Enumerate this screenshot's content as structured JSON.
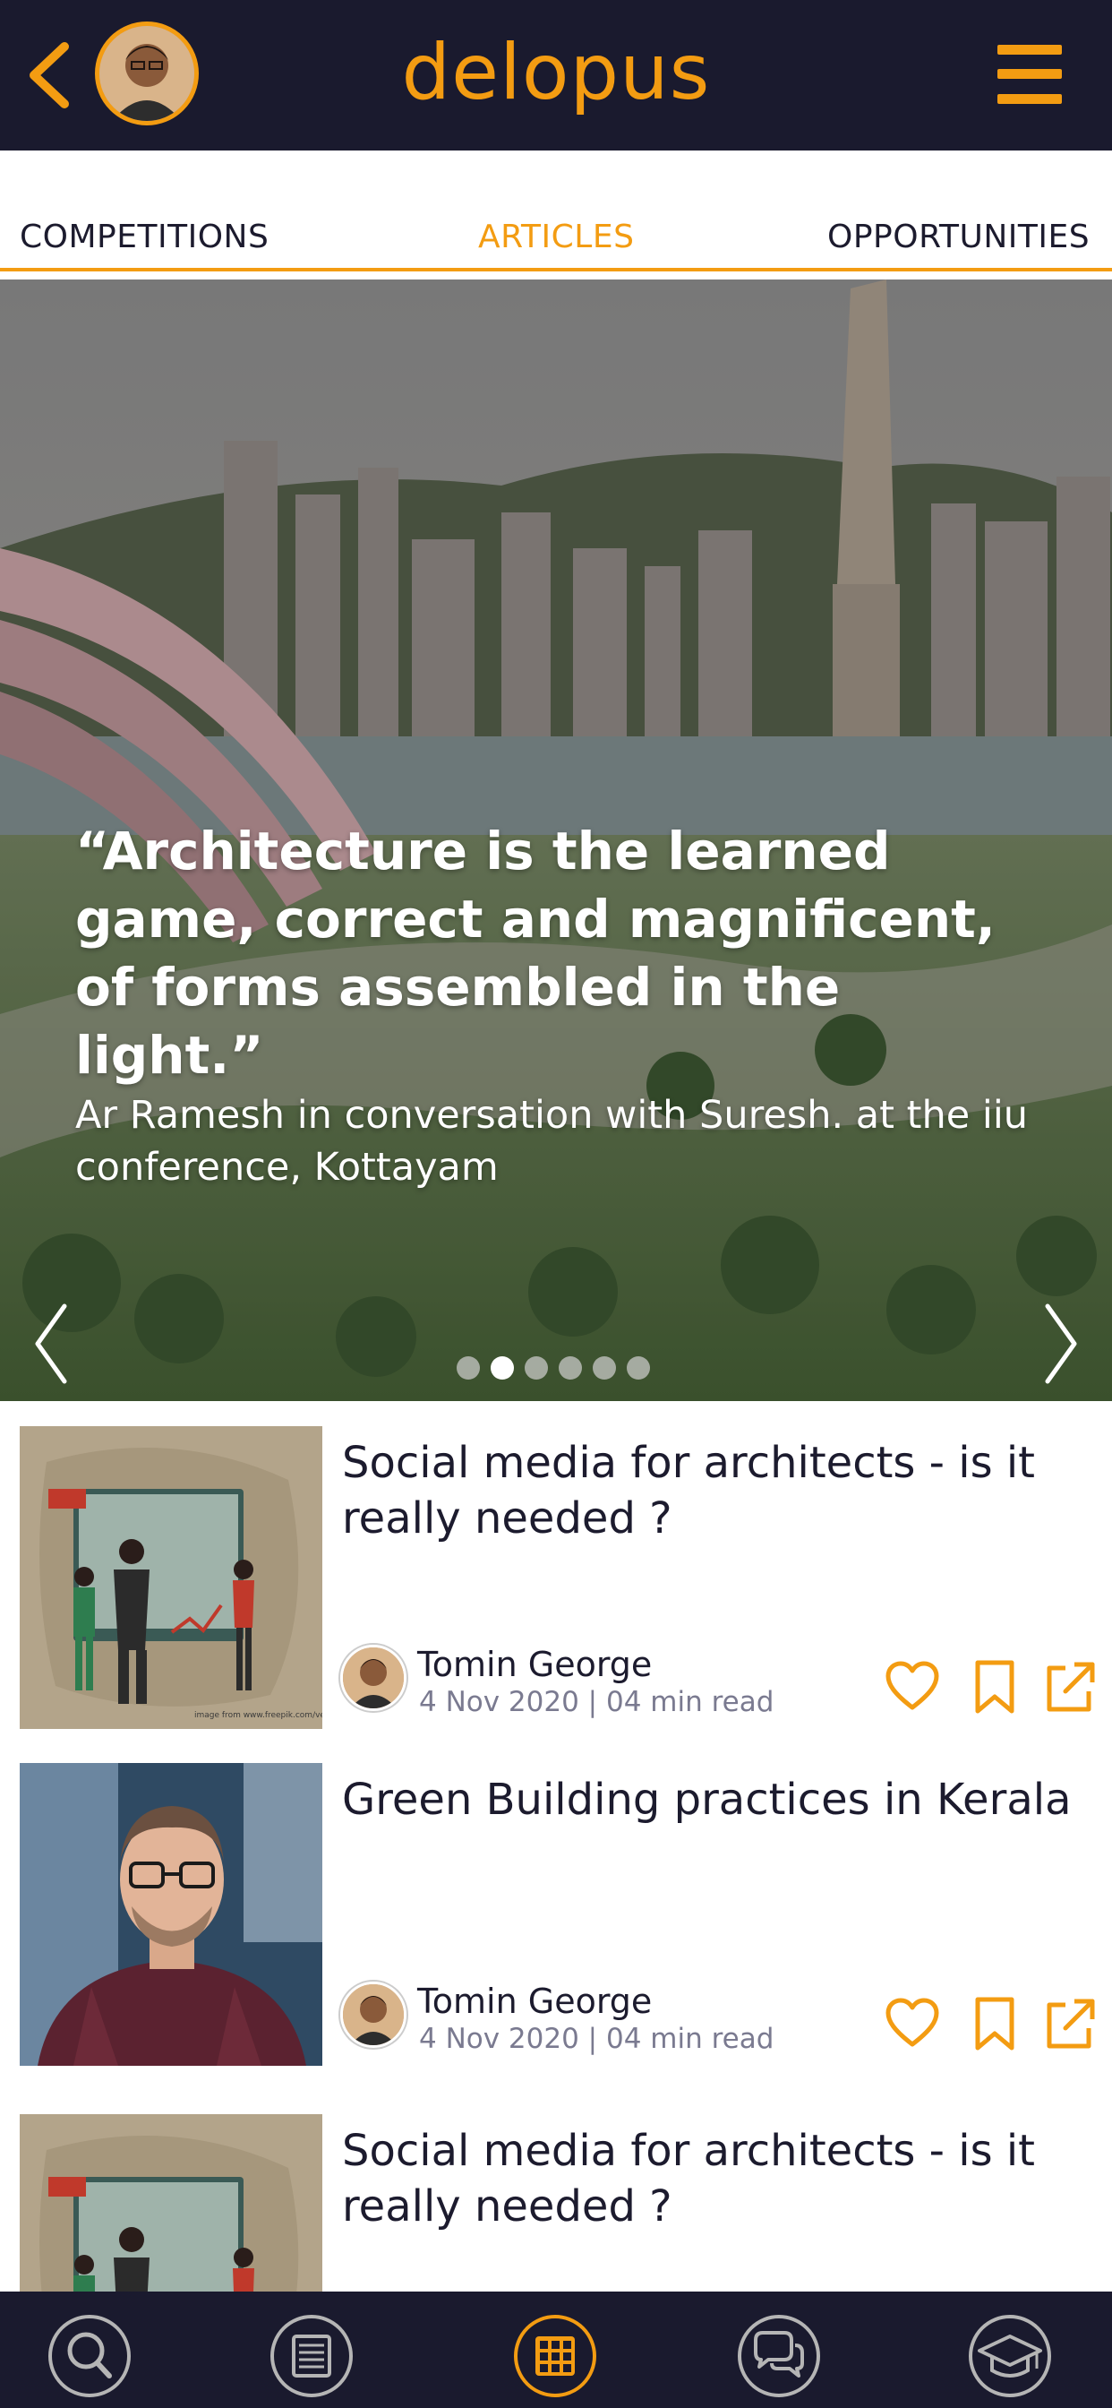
{
  "header": {
    "app_name": "delopus",
    "back_icon": "chevron-left-icon",
    "menu_icon": "hamburger-menu-icon",
    "accent_color": "#f39c12",
    "bg_color": "#1a1a2e"
  },
  "tabs": [
    {
      "label": "COMPETITIONS",
      "active": false
    },
    {
      "label": "ARTICLES",
      "active": true
    },
    {
      "label": "OPPORTUNITIES",
      "active": false
    }
  ],
  "hero": {
    "quote": "“Architecture is the learned game, correct and magnificent, of forms assembled in the light.”",
    "caption": "Ar Ramesh in conversation with Suresh. at the iiu conference, Kottayam",
    "slide_count": 6,
    "active_slide": 2
  },
  "articles": [
    {
      "title": "Social media for architects -  is it really needed ?",
      "author": "Tomin George",
      "meta": "4 Nov 2020 | 04 min read",
      "thumb_caption": "image from www.freepik.com/vectors"
    },
    {
      "title": "Green Building practices in Kerala",
      "author": "Tomin George",
      "meta": "4 Nov 2020 | 04 min read"
    },
    {
      "title": "Social media for architects -  is it really needed ?"
    }
  ],
  "article_actions": [
    "heart-icon",
    "bookmark-icon",
    "share-external-icon"
  ],
  "bottom_nav": [
    {
      "icon": "search-icon",
      "active": false
    },
    {
      "icon": "articles-icon",
      "active": false
    },
    {
      "icon": "grid-icon",
      "active": true
    },
    {
      "icon": "chat-icon",
      "active": false
    },
    {
      "icon": "graduation-cap-icon",
      "active": false
    }
  ]
}
